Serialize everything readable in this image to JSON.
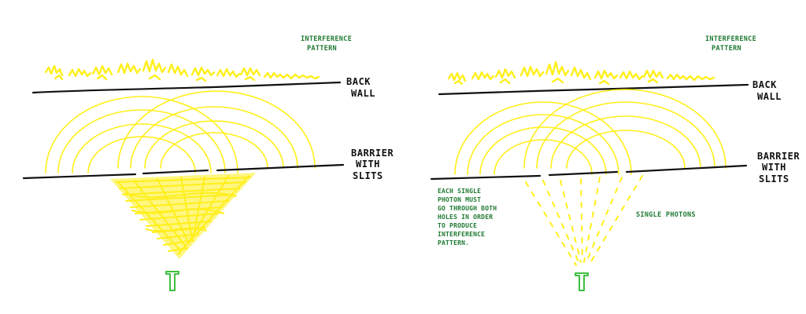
{
  "colors": {
    "light": "#ffef1a",
    "ink": "#111111",
    "annotation": "#1f7a33",
    "source_fill": "#ffffff",
    "source_stroke": "#3fbf3f"
  },
  "panels": [
    {
      "title": "wave-experiment",
      "annotation_top": [
        "INTERFERENCE",
        "PATTERN"
      ],
      "back_wall_label": [
        "BACK",
        "WALL"
      ],
      "barrier_label": [
        "BARRIER",
        "WITH",
        "SLITS"
      ],
      "incoming_light": "continuous-beam",
      "side_note": []
    },
    {
      "title": "single-photon-experiment",
      "annotation_top": [
        "INTERFERENCE",
        "PATTERN"
      ],
      "back_wall_label": [
        "BACK",
        "WALL"
      ],
      "barrier_label": [
        "BARRIER",
        "WITH",
        "SLITS"
      ],
      "incoming_light": "dashed-photon-paths",
      "photons_label": "SINGLE PHOTONS",
      "side_note": [
        "EACH SINGLE",
        "PHOTON MUST",
        "GO THROUGH BOTH",
        "HOLES IN ORDER",
        "TO PRODUCE",
        "INTERFERENCE",
        "PATTERN."
      ]
    }
  ],
  "icons": {
    "source": "light-source-icon"
  }
}
